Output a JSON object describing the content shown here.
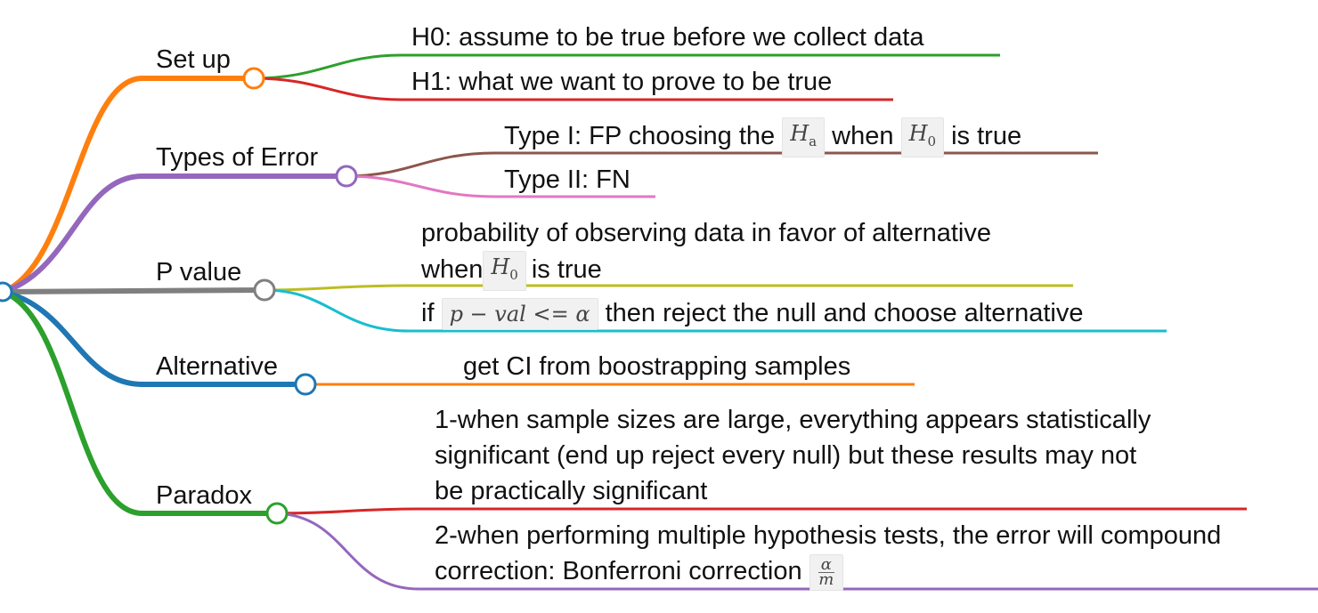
{
  "branches": {
    "setup": {
      "label": "Set up",
      "color": "#ff7f0e",
      "leaves": [
        {
          "text": "H0: assume to be true before we collect data",
          "color": "#2ca02c"
        },
        {
          "text": "H1: what we want to prove to be true",
          "color": "#d62728"
        }
      ]
    },
    "errors": {
      "label": "Types of Error",
      "color": "#9467bd",
      "leaves": [
        {
          "pre": "Type I: FP choosing the",
          "math1": "Ha",
          "mid": "when",
          "math2": "H0",
          "post": "is true",
          "color": "#8c564b"
        },
        {
          "text": "Type II: FN",
          "color": "#e377c2"
        }
      ]
    },
    "pvalue": {
      "label": "P value",
      "color": "#7f7f7f",
      "leaves": [
        {
          "line1": "probability of observing data in favor of alternative",
          "pre": "when",
          "math": "H0",
          "post": "is true",
          "color": "#bcbd22"
        },
        {
          "pre": "if",
          "math": "p − val <= α",
          "post": "then reject the null and choose alternative",
          "color": "#17becf"
        }
      ]
    },
    "alternative": {
      "label": "Alternative",
      "color": "#1f77b4",
      "leaves": [
        {
          "text": "get CI from boostrapping samples",
          "color": "#ff7f0e"
        }
      ]
    },
    "paradox": {
      "label": "Paradox",
      "color": "#2ca02c",
      "leaves": [
        {
          "line1": "1-when sample sizes are large, everything appears statistically",
          "line2": "significant (end up reject every null) but these results may not",
          "line3": "be practically significant",
          "color": "#d62728"
        },
        {
          "line1": "2-when performing multiple hypothesis tests, the error will compound",
          "pre": "correction: Bonferroni correction",
          "num": "α",
          "den": "m",
          "color": "#9467bd"
        }
      ]
    }
  }
}
